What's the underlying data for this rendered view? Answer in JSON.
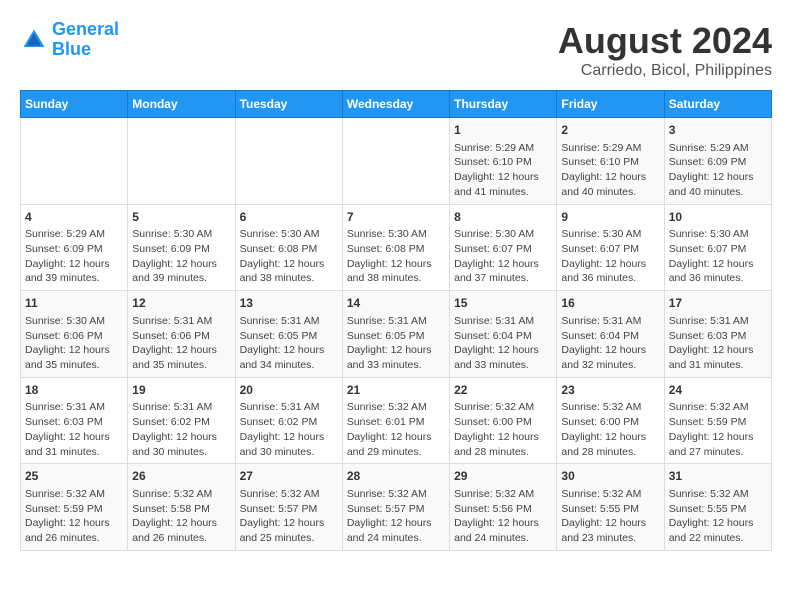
{
  "header": {
    "logo_line1": "General",
    "logo_line2": "Blue",
    "main_title": "August 2024",
    "subtitle": "Carriedo, Bicol, Philippines"
  },
  "days_of_week": [
    "Sunday",
    "Monday",
    "Tuesday",
    "Wednesday",
    "Thursday",
    "Friday",
    "Saturday"
  ],
  "weeks": [
    [
      {
        "day": "",
        "info": ""
      },
      {
        "day": "",
        "info": ""
      },
      {
        "day": "",
        "info": ""
      },
      {
        "day": "",
        "info": ""
      },
      {
        "day": "1",
        "info": "Sunrise: 5:29 AM\nSunset: 6:10 PM\nDaylight: 12 hours\nand 41 minutes."
      },
      {
        "day": "2",
        "info": "Sunrise: 5:29 AM\nSunset: 6:10 PM\nDaylight: 12 hours\nand 40 minutes."
      },
      {
        "day": "3",
        "info": "Sunrise: 5:29 AM\nSunset: 6:09 PM\nDaylight: 12 hours\nand 40 minutes."
      }
    ],
    [
      {
        "day": "4",
        "info": "Sunrise: 5:29 AM\nSunset: 6:09 PM\nDaylight: 12 hours\nand 39 minutes."
      },
      {
        "day": "5",
        "info": "Sunrise: 5:30 AM\nSunset: 6:09 PM\nDaylight: 12 hours\nand 39 minutes."
      },
      {
        "day": "6",
        "info": "Sunrise: 5:30 AM\nSunset: 6:08 PM\nDaylight: 12 hours\nand 38 minutes."
      },
      {
        "day": "7",
        "info": "Sunrise: 5:30 AM\nSunset: 6:08 PM\nDaylight: 12 hours\nand 38 minutes."
      },
      {
        "day": "8",
        "info": "Sunrise: 5:30 AM\nSunset: 6:07 PM\nDaylight: 12 hours\nand 37 minutes."
      },
      {
        "day": "9",
        "info": "Sunrise: 5:30 AM\nSunset: 6:07 PM\nDaylight: 12 hours\nand 36 minutes."
      },
      {
        "day": "10",
        "info": "Sunrise: 5:30 AM\nSunset: 6:07 PM\nDaylight: 12 hours\nand 36 minutes."
      }
    ],
    [
      {
        "day": "11",
        "info": "Sunrise: 5:30 AM\nSunset: 6:06 PM\nDaylight: 12 hours\nand 35 minutes."
      },
      {
        "day": "12",
        "info": "Sunrise: 5:31 AM\nSunset: 6:06 PM\nDaylight: 12 hours\nand 35 minutes."
      },
      {
        "day": "13",
        "info": "Sunrise: 5:31 AM\nSunset: 6:05 PM\nDaylight: 12 hours\nand 34 minutes."
      },
      {
        "day": "14",
        "info": "Sunrise: 5:31 AM\nSunset: 6:05 PM\nDaylight: 12 hours\nand 33 minutes."
      },
      {
        "day": "15",
        "info": "Sunrise: 5:31 AM\nSunset: 6:04 PM\nDaylight: 12 hours\nand 33 minutes."
      },
      {
        "day": "16",
        "info": "Sunrise: 5:31 AM\nSunset: 6:04 PM\nDaylight: 12 hours\nand 32 minutes."
      },
      {
        "day": "17",
        "info": "Sunrise: 5:31 AM\nSunset: 6:03 PM\nDaylight: 12 hours\nand 31 minutes."
      }
    ],
    [
      {
        "day": "18",
        "info": "Sunrise: 5:31 AM\nSunset: 6:03 PM\nDaylight: 12 hours\nand 31 minutes."
      },
      {
        "day": "19",
        "info": "Sunrise: 5:31 AM\nSunset: 6:02 PM\nDaylight: 12 hours\nand 30 minutes."
      },
      {
        "day": "20",
        "info": "Sunrise: 5:31 AM\nSunset: 6:02 PM\nDaylight: 12 hours\nand 30 minutes."
      },
      {
        "day": "21",
        "info": "Sunrise: 5:32 AM\nSunset: 6:01 PM\nDaylight: 12 hours\nand 29 minutes."
      },
      {
        "day": "22",
        "info": "Sunrise: 5:32 AM\nSunset: 6:00 PM\nDaylight: 12 hours\nand 28 minutes."
      },
      {
        "day": "23",
        "info": "Sunrise: 5:32 AM\nSunset: 6:00 PM\nDaylight: 12 hours\nand 28 minutes."
      },
      {
        "day": "24",
        "info": "Sunrise: 5:32 AM\nSunset: 5:59 PM\nDaylight: 12 hours\nand 27 minutes."
      }
    ],
    [
      {
        "day": "25",
        "info": "Sunrise: 5:32 AM\nSunset: 5:59 PM\nDaylight: 12 hours\nand 26 minutes."
      },
      {
        "day": "26",
        "info": "Sunrise: 5:32 AM\nSunset: 5:58 PM\nDaylight: 12 hours\nand 26 minutes."
      },
      {
        "day": "27",
        "info": "Sunrise: 5:32 AM\nSunset: 5:57 PM\nDaylight: 12 hours\nand 25 minutes."
      },
      {
        "day": "28",
        "info": "Sunrise: 5:32 AM\nSunset: 5:57 PM\nDaylight: 12 hours\nand 24 minutes."
      },
      {
        "day": "29",
        "info": "Sunrise: 5:32 AM\nSunset: 5:56 PM\nDaylight: 12 hours\nand 24 minutes."
      },
      {
        "day": "30",
        "info": "Sunrise: 5:32 AM\nSunset: 5:55 PM\nDaylight: 12 hours\nand 23 minutes."
      },
      {
        "day": "31",
        "info": "Sunrise: 5:32 AM\nSunset: 5:55 PM\nDaylight: 12 hours\nand 22 minutes."
      }
    ]
  ]
}
